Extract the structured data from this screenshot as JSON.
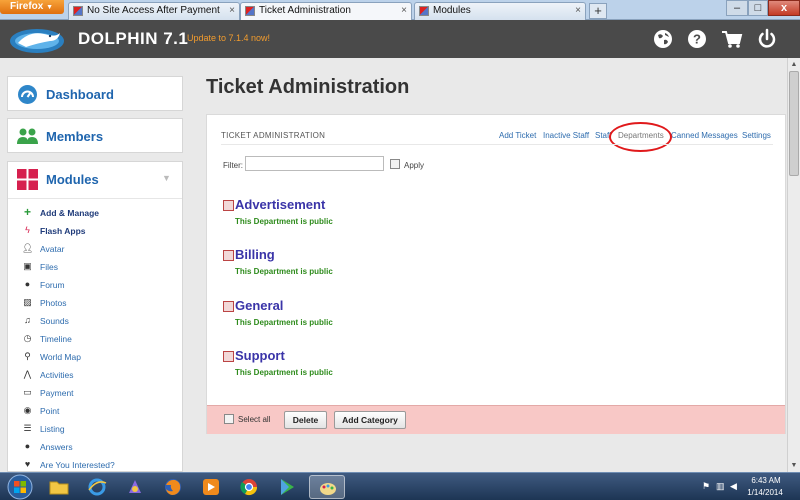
{
  "browser": {
    "button_label": "Firefox",
    "tabs": [
      {
        "title": "No Site Access After Payment",
        "close": "×"
      },
      {
        "title": "Ticket Administration",
        "close": "×"
      },
      {
        "title": "Modules",
        "close": "×"
      }
    ],
    "new_tab": "+",
    "minimize": "–",
    "maximize": "□",
    "close": "x"
  },
  "header": {
    "brand": "DOLPHIN 7.1",
    "update_link": "Update to 7.1.4 now!"
  },
  "sidebar": {
    "dashboard": "Dashboard",
    "members": "Members",
    "modules": "Modules",
    "items": [
      {
        "label": "Add & Manage",
        "icon": "plus-icon"
      },
      {
        "label": "Flash Apps",
        "icon": "flash-icon"
      },
      {
        "label": "Avatar",
        "icon": "user-icon"
      },
      {
        "label": "Files",
        "icon": "save-icon"
      },
      {
        "label": "Forum",
        "icon": "chat-icon"
      },
      {
        "label": "Photos",
        "icon": "picture-icon"
      },
      {
        "label": "Sounds",
        "icon": "music-icon"
      },
      {
        "label": "Timeline",
        "icon": "clock-icon"
      },
      {
        "label": "World Map",
        "icon": "map-marker-icon"
      },
      {
        "label": "Activities",
        "icon": "activity-icon"
      },
      {
        "label": "Payment",
        "icon": "credit-card-icon"
      },
      {
        "label": "Point",
        "icon": "target-icon"
      },
      {
        "label": "Listing",
        "icon": "list-icon"
      },
      {
        "label": "Answers",
        "icon": "answer-icon"
      },
      {
        "label": "Are You Interested?",
        "icon": "heart-icon"
      }
    ]
  },
  "main": {
    "page_title": "Ticket Administration",
    "panel_title": "TICKET ADMINISTRATION",
    "nav": {
      "add_ticket": "Add Ticket",
      "inactive_staff": "Inactive Staff",
      "staff": "Staff",
      "departments": "Departments",
      "canned_messages": "Canned Messages",
      "settings": "Settings"
    },
    "filter_label": "Filter:",
    "filter_value": "",
    "apply_label": "Apply",
    "departments": [
      {
        "name": "Advertisement",
        "status": "This Department is public"
      },
      {
        "name": "Billing",
        "status": "This Department is public"
      },
      {
        "name": "General",
        "status": "This Department is public"
      },
      {
        "name": "Support",
        "status": "This Department is public"
      }
    ],
    "footer": {
      "select_all": "Select all",
      "delete": "Delete",
      "add_category": "Add Category"
    }
  },
  "taskbar": {
    "time": "6:43 AM",
    "date": "1/14/2014"
  },
  "colors": {
    "link": "#2e6cae",
    "department_name": "#3a34a8",
    "public_status": "#2e8b1c",
    "footer_bg": "#f8c8c6",
    "highlight_circle": "#e0191b",
    "header_bg": "#4a4a4a",
    "update_link": "#f29c2e"
  }
}
